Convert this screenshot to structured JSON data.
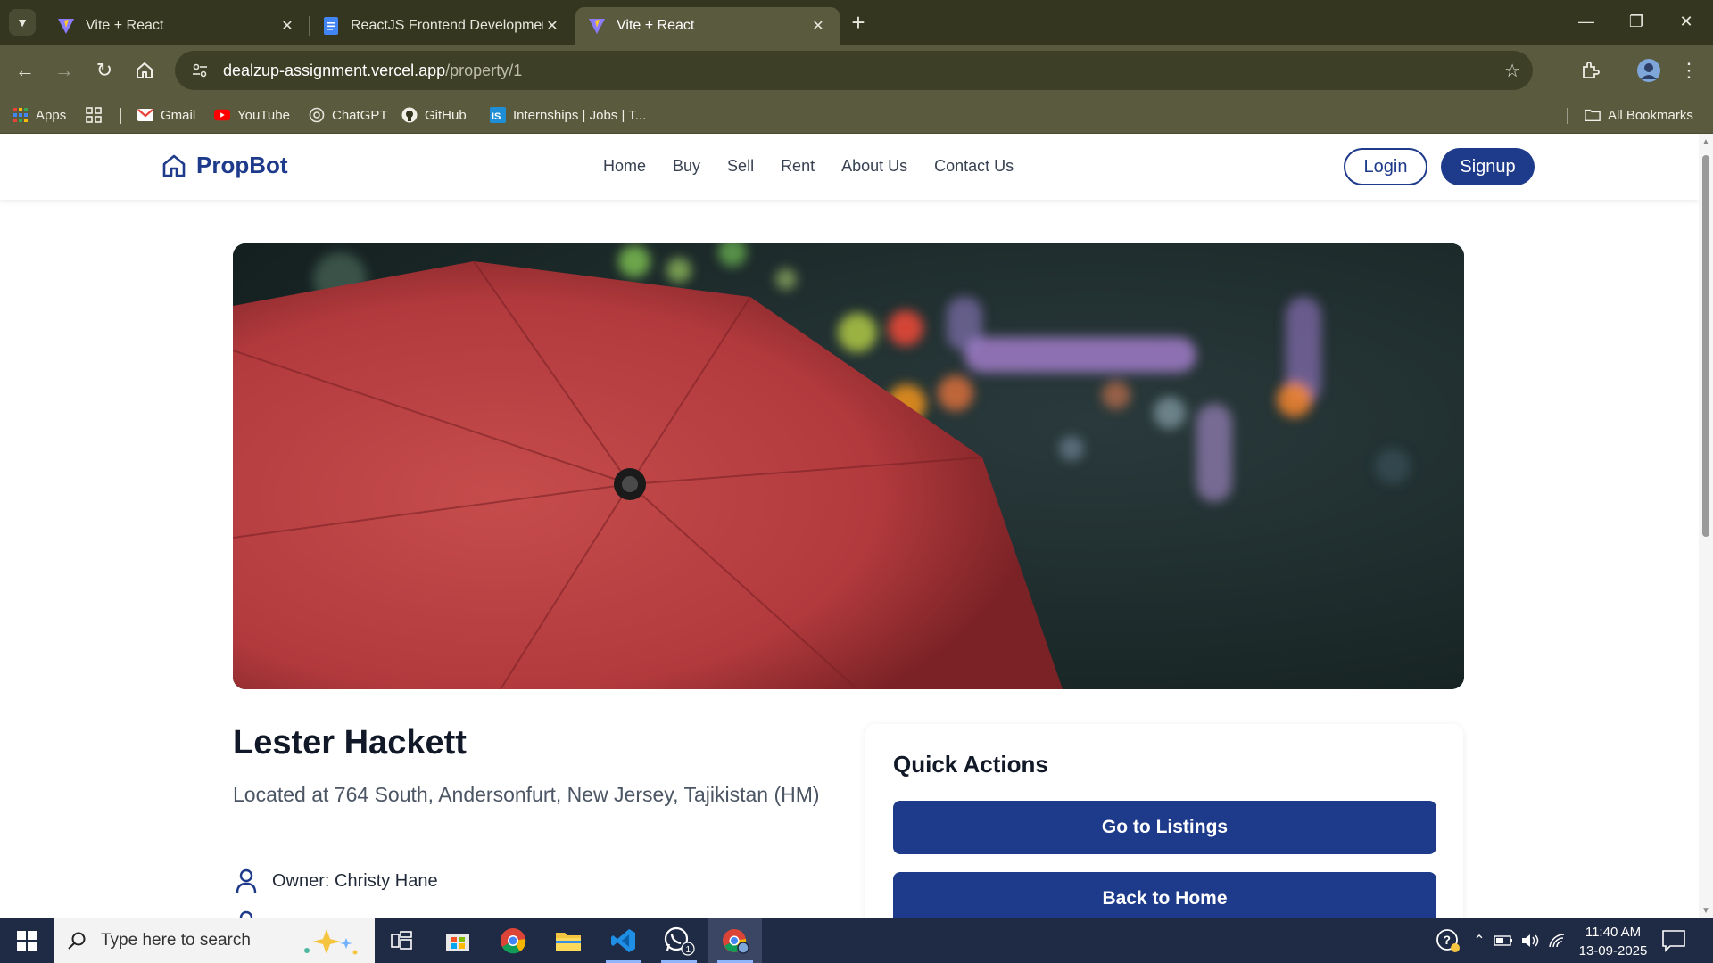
{
  "browser": {
    "tabs": [
      {
        "title": "Vite + React",
        "favicon": "vite-icon",
        "active": false
      },
      {
        "title": "ReactJS Frontend Development",
        "favicon": "docs-icon",
        "active": false
      },
      {
        "title": "Vite + React",
        "favicon": "vite-icon",
        "active": true
      }
    ],
    "address": {
      "host": "dealzup-assignment.vercel.app",
      "path": "/property/1"
    },
    "bookmarks": [
      {
        "label": "Apps",
        "icon": "apps-grid-icon"
      },
      {
        "label": "",
        "icon": "tab-groups-icon"
      },
      {
        "label": "Gmail",
        "icon": "gmail-icon"
      },
      {
        "label": "YouTube",
        "icon": "youtube-icon"
      },
      {
        "label": "ChatGPT",
        "icon": "chatgpt-icon"
      },
      {
        "label": "GitHub",
        "icon": "github-icon"
      },
      {
        "label": "Internships | Jobs | T...",
        "icon": "internshala-icon"
      }
    ],
    "all_bookmarks_label": "All Bookmarks"
  },
  "site": {
    "brand": "PropBot",
    "nav": [
      "Home",
      "Buy",
      "Sell",
      "Rent",
      "About Us",
      "Contact Us"
    ],
    "login_label": "Login",
    "signup_label": "Signup"
  },
  "property": {
    "title": "Lester Hackett",
    "address": "Located at 764 South, Andersonfurt, New Jersey, Tajikistan (HM)",
    "owner": "Owner: Christy Hane",
    "image_subject": "red umbrella in rain with city bokeh lights"
  },
  "quick_actions": {
    "title": "Quick Actions",
    "buttons": [
      "Go to Listings",
      "Back to Home"
    ]
  },
  "taskbar": {
    "search_placeholder": "Type here to search",
    "time": "11:40 AM",
    "date": "13-09-2025",
    "whatsapp_badge": "1"
  },
  "colors": {
    "brand_primary": "#1e3a8a",
    "browser_frame": "#35361f",
    "browser_toolbar": "#5a5b3e"
  }
}
